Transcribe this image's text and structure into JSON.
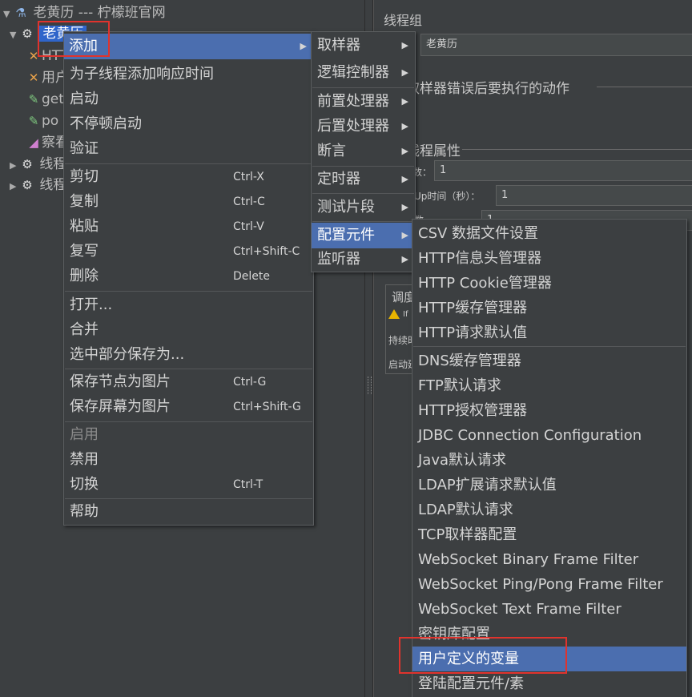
{
  "tree": {
    "root": "老黄历 --- 柠檬班官网",
    "thread_group": "老黄历",
    "children": [
      "HTT",
      "用户",
      "get",
      "po",
      "察看"
    ],
    "other_groups": [
      "线程",
      "线程"
    ]
  },
  "right_panel": {
    "title": "线程组",
    "name_value": "老黄历",
    "on_error_title": "取样器错误后要执行的动作",
    "props_title": "线程属性",
    "threads_label": "数：",
    "threads_value": "1",
    "rampup_label": "Up时间（秒）：",
    "rampup_value": "1",
    "loop_label": "数",
    "loop_value": "1",
    "scheduler_title": "调度",
    "scheduler_warn": "If",
    "duration_label": "持续时",
    "startup_label": "启动延"
  },
  "context_menu": {
    "items": [
      {
        "label": "添加",
        "submenu": true
      },
      {
        "label": "为子线程添加响应时间"
      },
      {
        "label": "启动"
      },
      {
        "label": "不停顿启动"
      },
      {
        "label": "验证"
      },
      {
        "label": "剪切",
        "shortcut": "Ctrl-X"
      },
      {
        "label": "复制",
        "shortcut": "Ctrl-C"
      },
      {
        "label": "粘贴",
        "shortcut": "Ctrl-V"
      },
      {
        "label": "复写",
        "shortcut": "Ctrl+Shift-C"
      },
      {
        "label": "删除",
        "shortcut": "Delete"
      },
      {
        "label": "打开..."
      },
      {
        "label": "合并"
      },
      {
        "label": "选中部分保存为..."
      },
      {
        "label": "保存节点为图片",
        "shortcut": "Ctrl-G"
      },
      {
        "label": "保存屏幕为图片",
        "shortcut": "Ctrl+Shift-G"
      },
      {
        "label": "启用",
        "disabled": true
      },
      {
        "label": "禁用"
      },
      {
        "label": "切换",
        "shortcut": "Ctrl-T"
      },
      {
        "label": "帮助"
      }
    ]
  },
  "add_menu": {
    "items": [
      "取样器",
      "逻辑控制器",
      "前置处理器",
      "后置处理器",
      "断言",
      "定时器",
      "测试片段",
      "配置元件",
      "监听器"
    ]
  },
  "config_menu": {
    "items": [
      "CSV 数据文件设置",
      "HTTP信息头管理器",
      "HTTP Cookie管理器",
      "HTTP缓存管理器",
      "HTTP请求默认值",
      "DNS缓存管理器",
      "FTP默认请求",
      "HTTP授权管理器",
      "JDBC Connection Configuration",
      "Java默认请求",
      "LDAP扩展请求默认值",
      "LDAP默认请求",
      "TCP取样器配置",
      "WebSocket Binary Frame Filter",
      "WebSocket Ping/Pong Frame Filter",
      "WebSocket Text Frame Filter",
      "密钥库配置",
      "用户定义的变量",
      "登陆配置元件/素"
    ]
  },
  "icons": {
    "test_plan": "flask-icon",
    "thread_group": "gear-icon",
    "sampler": "crossed-tools-icon",
    "processor": "pipette-icon",
    "listener": "graph-icon",
    "submenu": "triangle-right-icon",
    "warning": "warning-icon"
  },
  "colors": {
    "background": "#3c3f41",
    "highlight": "#4b6eaf",
    "selection": "#2f65ca",
    "annotation": "#e0332d"
  }
}
